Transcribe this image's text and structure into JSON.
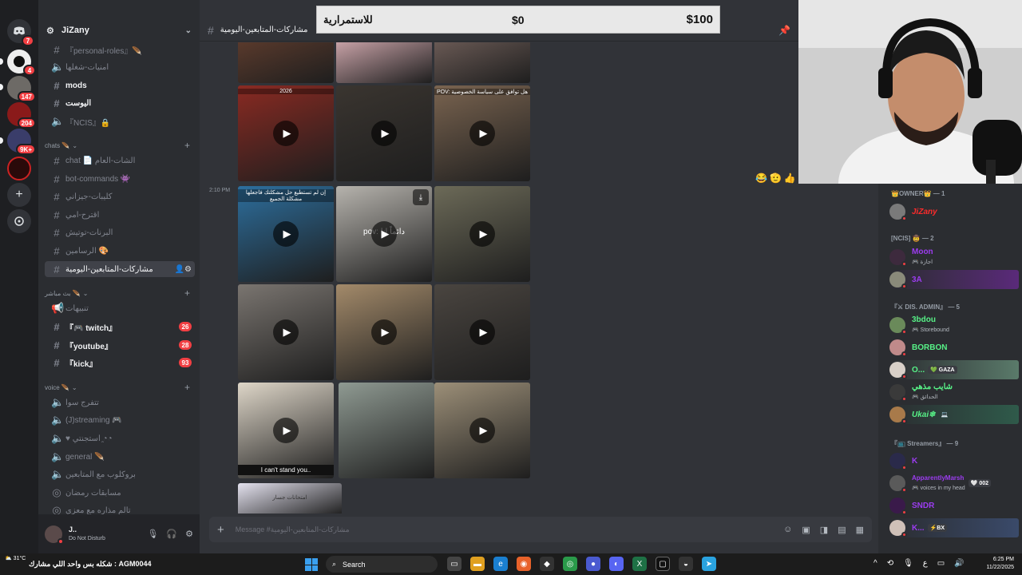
{
  "server": {
    "name": "JiZany",
    "rail_badges": [
      "7",
      "4",
      "147",
      "204",
      "9K+"
    ]
  },
  "sidebar": {
    "items": [
      {
        "label": "『personal-roles』🪶",
        "type": "text",
        "style": "dim"
      },
      {
        "label": "امنيات-شغلها",
        "type": "text",
        "style": "dim"
      },
      {
        "label": "mods",
        "type": "text",
        "style": "bright"
      },
      {
        "label": "اليوست",
        "type": "text",
        "style": "bright"
      },
      {
        "label": "『NCIS』🔒",
        "type": "voice",
        "style": "dim"
      },
      {
        "category": "chats 🪶"
      },
      {
        "label": "chat 📄 الشات-العام",
        "type": "text",
        "style": "dim"
      },
      {
        "label": "bot-commands 👾",
        "type": "text",
        "style": "dim"
      },
      {
        "label": "كليبات-جيزاني",
        "type": "text",
        "style": "dim"
      },
      {
        "label": "اقترح-امي",
        "type": "text",
        "style": "dim"
      },
      {
        "label": "البرنات-توتيش",
        "type": "text",
        "style": "dim"
      },
      {
        "label": "الرسامين 🎨",
        "type": "text",
        "style": "dim"
      },
      {
        "label": "مشاركات-المتابعين-اليومية",
        "type": "text",
        "style": "active"
      },
      {
        "category": "بث مباشر 🪶"
      },
      {
        "label": "تنبيهات",
        "type": "voice",
        "style": "dim"
      },
      {
        "label": "『🎮 twitch』",
        "type": "text",
        "style": "bright",
        "count": "26"
      },
      {
        "label": "『youtube』",
        "type": "text",
        "style": "bright",
        "count": "28"
      },
      {
        "label": "『kick』",
        "type": "text",
        "style": "bright",
        "count": "93"
      },
      {
        "category": "voice 🪶"
      },
      {
        "label": "تتفرج سوا",
        "type": "voice",
        "style": "dim"
      },
      {
        "label": "(J)streaming 🎮",
        "type": "voice",
        "style": "dim"
      },
      {
        "label": "♥ استجنتي ◔̯◔",
        "type": "voice",
        "style": "dim"
      },
      {
        "label": "general 🪶",
        "type": "voice",
        "style": "dim"
      },
      {
        "label": "بروكلوب مع المتابعين",
        "type": "voice",
        "style": "dim"
      },
      {
        "label": "مسابقات رمضان",
        "type": "voice",
        "style": "dim"
      },
      {
        "label": "تالم مذاره مع معزي",
        "type": "voice",
        "style": "dim"
      }
    ]
  },
  "user_panel": {
    "name": "J..",
    "status": "Do Not Disturb"
  },
  "chat": {
    "channel_name": "مشاركات-المتابعين-اليومية",
    "timestamp": "2:10 PM",
    "composer_placeholder": "Message #مشاركات-المتابعين-اليومية",
    "thumbs": [
      {
        "caption": "",
        "bottom": "",
        "bg": "#5a3a2c",
        "play": false
      },
      {
        "caption": "",
        "bottom": "",
        "bg": "#c9a3a8",
        "play": false
      },
      {
        "caption": "",
        "bottom": "",
        "bg": "#6a5a55",
        "play": false
      },
      {
        "caption": "2026",
        "bottom": "",
        "bg": "#8a2a22",
        "play": true
      },
      {
        "caption": "",
        "bottom": "",
        "bg": "#3a3530",
        "play": true
      },
      {
        "caption": "POV: هل توافق على سياسة الخصوصية",
        "bottom": "",
        "bg": "#7a6450",
        "play": true
      },
      {
        "caption": "إن لم تستطيع حل مشكلتك فاجعلها مشكلة الجميع",
        "bottom": "",
        "bg": "#2d6f9e",
        "play": true
      },
      {
        "caption": "pov: دائماً انا",
        "bottom": "",
        "bg": "#b6b3ad",
        "play": true
      },
      {
        "caption": "",
        "bottom": "",
        "bg": "#6c6a58",
        "play": true
      },
      {
        "caption": "",
        "bottom": "",
        "bg": "#7a7570",
        "play": true
      },
      {
        "caption": "",
        "bottom": "",
        "bg": "#a38a6a",
        "play": true
      },
      {
        "caption": "",
        "bottom": "",
        "bg": "#4a4540",
        "play": true
      },
      {
        "caption": "",
        "bottom": "I can't stand you..",
        "bg": "#ded6c8",
        "play": true
      },
      {
        "caption": "",
        "bottom": "",
        "bg": "#8f9a92",
        "play": false
      },
      {
        "caption": "",
        "bottom": "",
        "bg": "#9c8f78",
        "play": true
      },
      {
        "caption": "امتحانات جسار",
        "bottom": "",
        "bg": "#e4e2ef",
        "play": false
      }
    ],
    "reactions": [
      "😂",
      "🫡",
      "👍"
    ]
  },
  "donation": {
    "label": "للاستمرارية",
    "current": "$0",
    "goal": "$100",
    "progress_fraction": 0.0
  },
  "members": {
    "groups": [
      {
        "label": "👑OWNER👑 — 1",
        "members": [
          {
            "name": "JiZany",
            "activity": "",
            "color": "#ff2b2b",
            "tag": ""
          }
        ]
      },
      {
        "label": "[NCIS] 🤠 — 2",
        "members": [
          {
            "name": "Moon",
            "activity": "🎮 اجازة",
            "color": "#9c3cf0",
            "tag": ""
          },
          {
            "name": "3A",
            "activity": "",
            "color": "#9c3cf0",
            "tag": ""
          }
        ]
      },
      {
        "label": "『⚔ DIS. ADMIN』 — 5",
        "members": [
          {
            "name": "3bdou",
            "activity": "🎮 Storebound",
            "color": "#57f287",
            "tag": ""
          },
          {
            "name": "BORBON",
            "activity": "",
            "color": "#57f287",
            "tag": ""
          },
          {
            "name": "O...",
            "activity": "",
            "color": "#57f287",
            "tag": "💚 GAZA"
          },
          {
            "name": "شايب مذهي",
            "activity": "🎮 الحدائق",
            "color": "#57f287",
            "tag": ""
          },
          {
            "name": "Ukai❄",
            "activity": "",
            "color": "#57f287",
            "tag": "💻"
          }
        ]
      },
      {
        "label": "『📺 Streamers』 — 9",
        "members": [
          {
            "name": "K",
            "activity": "",
            "color": "#9c3cf0",
            "tag": ""
          },
          {
            "name": "ApparentlyMarsh",
            "activity": "🎮 voices in my head",
            "color": "#9c3cf0",
            "tag": "🤍 002"
          },
          {
            "name": "SNDR",
            "activity": "",
            "color": "#9c3cf0",
            "tag": ""
          },
          {
            "name": "K...",
            "activity": "",
            "color": "#9c3cf0",
            "tag": "⚡BX"
          }
        ]
      }
    ]
  },
  "taskbar": {
    "temp": "31°C",
    "ticker": "شكله بس واحد اللي مشارك : AGM0044",
    "search_label": "Search",
    "time": "6:25 PM",
    "date": "11/22/2025",
    "lang": "ع",
    "apps": [
      "explorer",
      "task-view",
      "folder",
      "edge",
      "firefox",
      "epic",
      "chrome",
      "app",
      "discord",
      "excel",
      "capcut",
      "obs",
      "telegram"
    ]
  },
  "colors": {
    "accent_red": "#f23f43",
    "active_channel": "#404249",
    "admin_green": "#57f287",
    "streamer_purple": "#9c3cf0"
  }
}
